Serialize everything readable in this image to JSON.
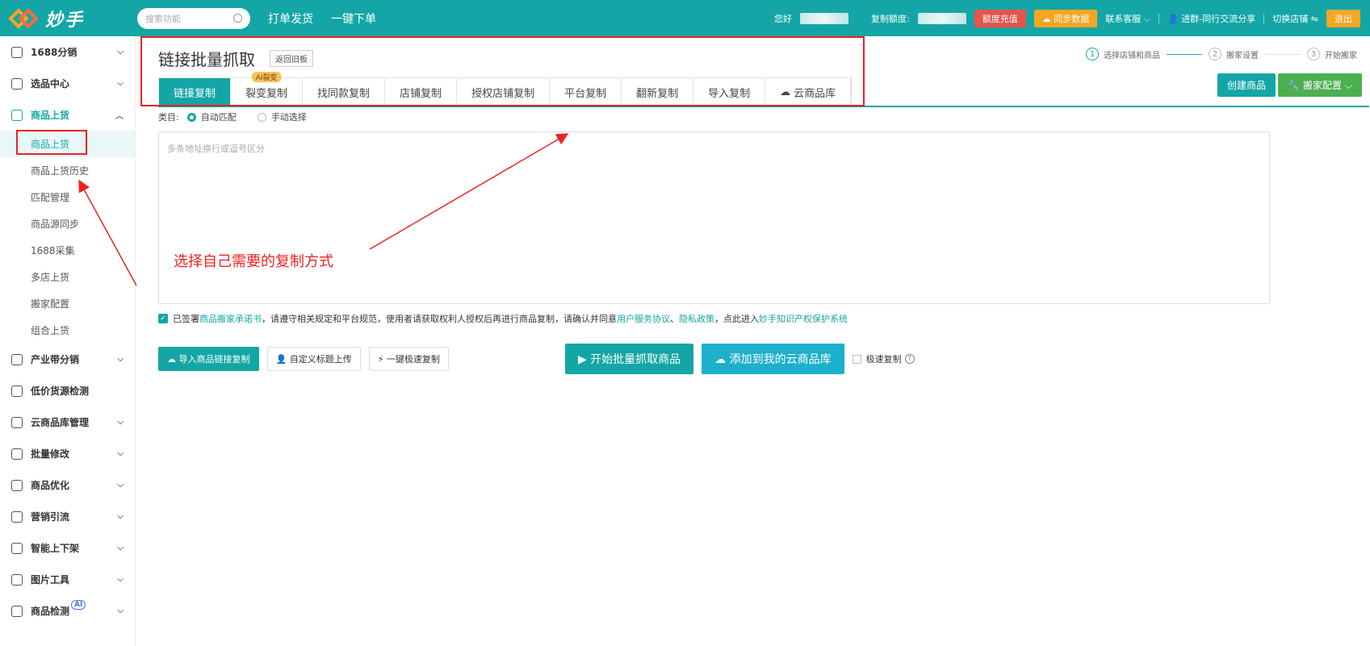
{
  "topbar": {
    "logo_text": "妙手",
    "search_placeholder": "搜索功能",
    "links": [
      "打单发货",
      "一键下单"
    ],
    "greeting": "您好",
    "quota_label": "复制额度:",
    "recharge": "额度充值",
    "sync": "同步数据",
    "support": "联系客服",
    "group": "进群-同行交流分享",
    "switch_shop": "切换店铺",
    "logout": "退出"
  },
  "sidebar": {
    "groups": [
      {
        "label": "1688分销",
        "icon": "cart-icon"
      },
      {
        "label": "选品中心",
        "icon": "box-icon"
      },
      {
        "label": "商品上货",
        "icon": "store-icon"
      }
    ],
    "sub_items": [
      "商品上货",
      "商品上货历史",
      "匹配管理",
      "商品源同步",
      "1688采集",
      "多店上货",
      "搬家配置",
      "组合上货"
    ],
    "groups_after": [
      {
        "label": "产业带分销"
      },
      {
        "label": "低价货源检测"
      },
      {
        "label": "云商品库管理"
      },
      {
        "label": "批量修改"
      },
      {
        "label": "商品优化"
      },
      {
        "label": "营销引流"
      },
      {
        "label": "智能上下架"
      },
      {
        "label": "图片工具"
      },
      {
        "label": "商品检测"
      }
    ],
    "ai_badge": "AI"
  },
  "main": {
    "title": "链接批量抓取",
    "back_label": "返回旧板",
    "steps": [
      "选择店铺和商品",
      "搬家设置",
      "开始搬家"
    ],
    "step_nums": [
      "1",
      "2",
      "3"
    ],
    "tabs": [
      "链接复制",
      "裂变复制",
      "找同款复制",
      "店铺复制",
      "授权店铺复制",
      "平台复制",
      "翻新复制",
      "导入复制",
      "云商品库"
    ],
    "tab_badge": "AI裂变",
    "create_btn": "创建商品",
    "move_btn": "搬家配置",
    "category_label": "类目:",
    "radio_auto": "自动匹配",
    "radio_manual": "手动选择",
    "textarea_placeholder": "多条地址换行或逗号区分",
    "annotation": "选择自己需要的复制方式",
    "agree": {
      "p1": "已签署",
      "l1": "商品搬家承诺书",
      "p2": "，请遵守相关规定和平台规范，使用者请获取权利人授权后再进行商品复制，请确认并同意",
      "l2": "用户服务协议",
      "p3": "、",
      "l3": "隐私政策",
      "p4": "，点此进入",
      "l4": "妙手知识产权保护系统"
    },
    "actions": {
      "import": "导入商品链接复制",
      "custom": "自定义标题上传",
      "quick": "一键极速复制",
      "start": "开始批量抓取商品",
      "add_cloud": "添加到我的云商品库",
      "fast": "极速复制"
    }
  },
  "colors": {
    "accent": "#14a6a6",
    "annotation": "#ee2222"
  }
}
